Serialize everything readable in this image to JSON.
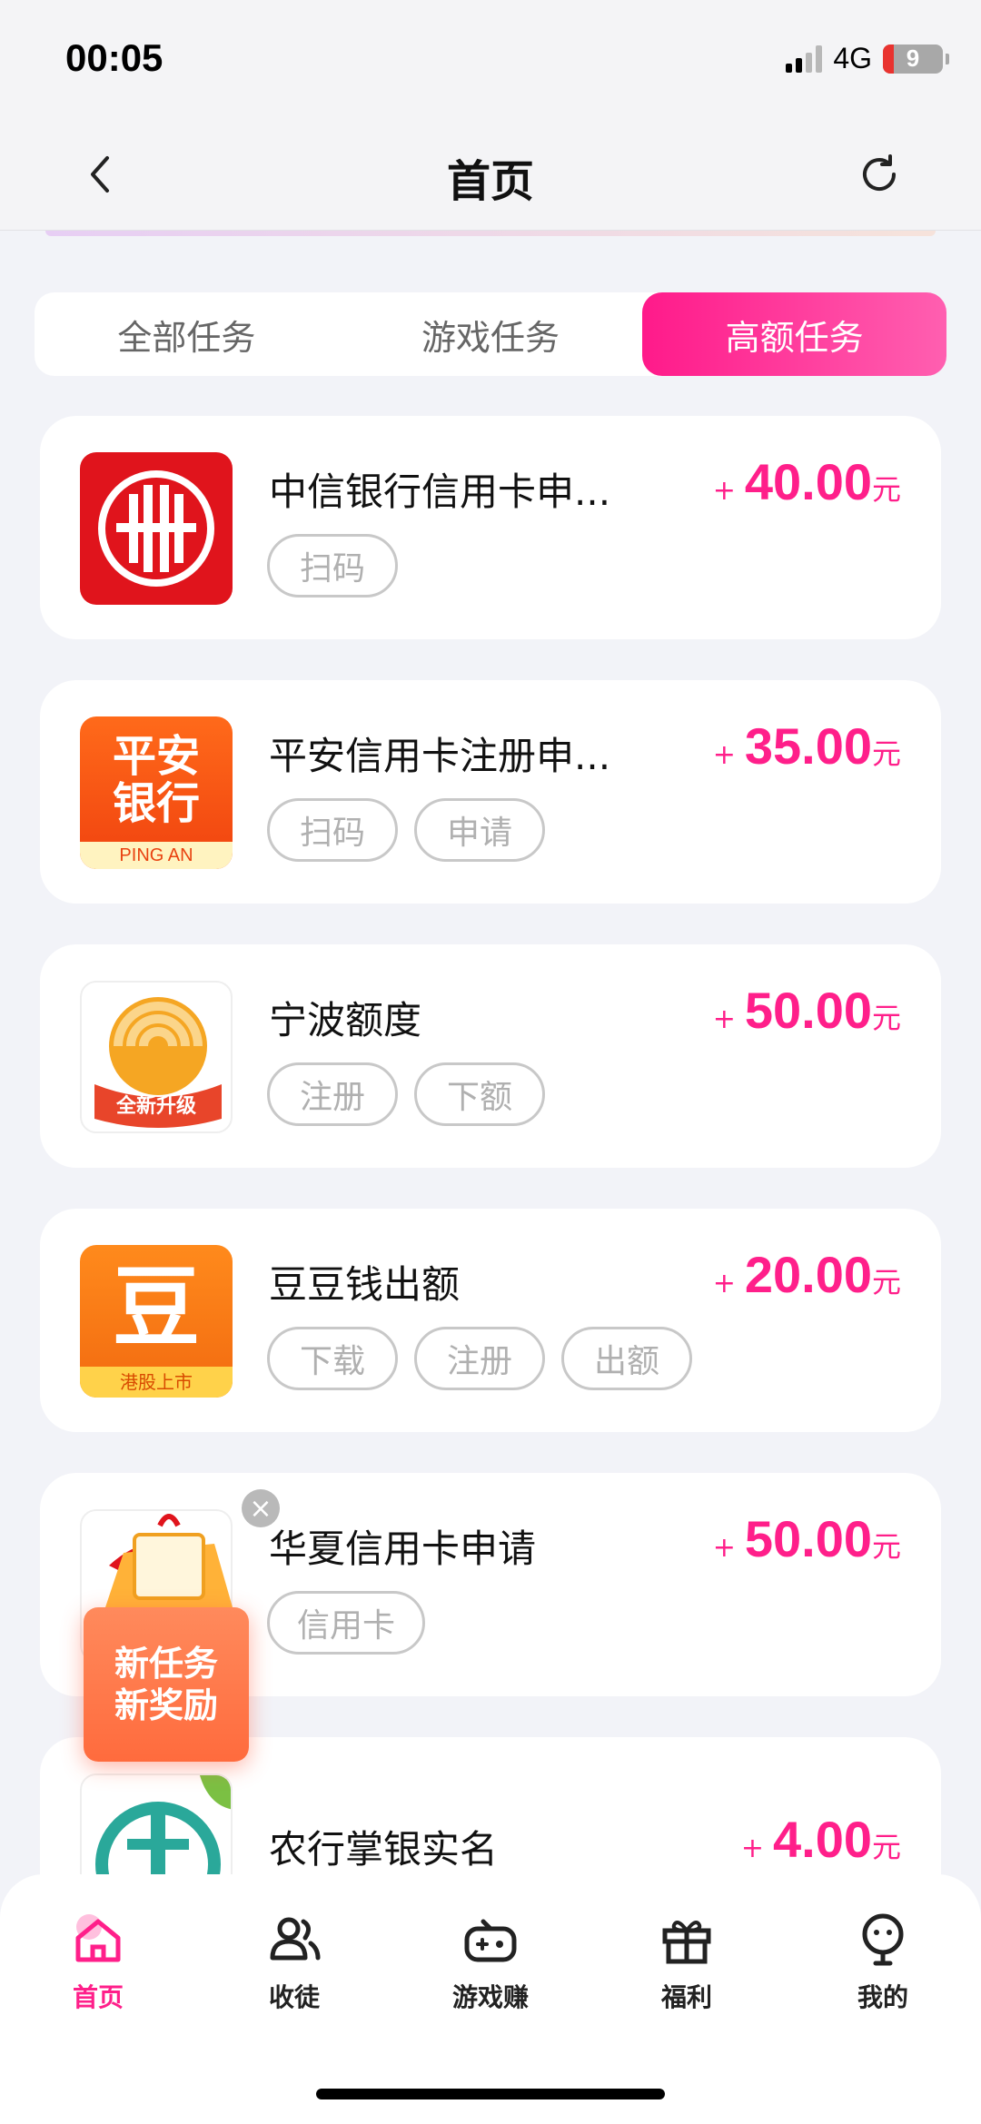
{
  "status_bar": {
    "time": "00:05",
    "network": "4G",
    "battery": "9"
  },
  "nav": {
    "title": "首页"
  },
  "tabs": [
    {
      "label": "全部任务",
      "active": false
    },
    {
      "label": "游戏任务",
      "active": false
    },
    {
      "label": "高额任务",
      "active": true
    }
  ],
  "tasks": [
    {
      "title": "中信银行信用卡申...",
      "tags": [
        "扫码"
      ],
      "plus": "+",
      "amount": "40.00",
      "unit": "元",
      "logo": "citic-bank-logo"
    },
    {
      "title": "平安信用卡注册申...",
      "tags": [
        "扫码",
        "申请"
      ],
      "plus": "+",
      "amount": "35.00",
      "unit": "元",
      "logo": "pingan-bank-logo",
      "logo_text": [
        "平安",
        "银行",
        "PING AN"
      ]
    },
    {
      "title": "宁波额度",
      "tags": [
        "注册",
        "下额"
      ],
      "plus": "+",
      "amount": "50.00",
      "unit": "元",
      "logo": "ningbo-logo",
      "logo_text": [
        "全新升级"
      ]
    },
    {
      "title": "豆豆钱出额",
      "tags": [
        "下载",
        "注册",
        "出额"
      ],
      "plus": "+",
      "amount": "20.00",
      "unit": "元",
      "logo": "doudouqian-logo",
      "logo_text": [
        "豆",
        "港股上市"
      ]
    },
    {
      "title": "华夏信用卡申请",
      "tags": [
        "信用卡"
      ],
      "plus": "+",
      "amount": "50.00",
      "unit": "元",
      "logo": "huaxia-logo"
    },
    {
      "title": "农行掌银实名",
      "tags": [],
      "plus": "+",
      "amount": "4.00",
      "unit": "元",
      "logo": "abc-bank-logo"
    }
  ],
  "promo": {
    "line1": "新任务",
    "line2": "新奖励"
  },
  "bottom_tabs": [
    {
      "label": "首页",
      "icon": "home-icon",
      "active": true
    },
    {
      "label": "收徒",
      "icon": "users-icon",
      "active": false
    },
    {
      "label": "游戏赚",
      "icon": "gamepad-icon",
      "active": false
    },
    {
      "label": "福利",
      "icon": "gift-icon",
      "active": false
    },
    {
      "label": "我的",
      "icon": "profile-icon",
      "active": false
    }
  ],
  "colors": {
    "accent": "#ff1f8a",
    "background": "#f2f3f8"
  }
}
